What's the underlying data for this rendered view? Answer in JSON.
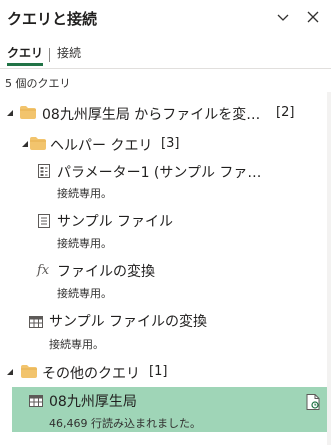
{
  "header": {
    "title": "クエリと接続"
  },
  "tabs": [
    {
      "label": "クエリ",
      "active": true
    },
    {
      "label": "接続",
      "active": false
    }
  ],
  "query_count": "5 個のクエリ",
  "tree": {
    "group_main": {
      "label": "08九州厚生局 からファイルを変…",
      "count": "[2]"
    },
    "group_helper": {
      "label": "ヘルパー クエリ",
      "count": "[3]"
    },
    "param": {
      "label": "パラメーター1 (サンプル ファ…",
      "status": "接続専用。"
    },
    "sample_file": {
      "label": "サンプル ファイル",
      "status": "接続専用。"
    },
    "transform_file": {
      "label": "ファイルの変換",
      "status": "接続専用。"
    },
    "transform_sample": {
      "label": "サンプル ファイルの変換",
      "status": "接続専用。"
    },
    "group_other": {
      "label": "その他のクエリ",
      "count": "[1]"
    },
    "selected_query": {
      "label": "08九州厚生局",
      "status": "46,469 行読み込まれました。"
    }
  },
  "colors": {
    "accent": "#217346",
    "selection": "#9fd5b7",
    "folder": "#f2c46d"
  }
}
